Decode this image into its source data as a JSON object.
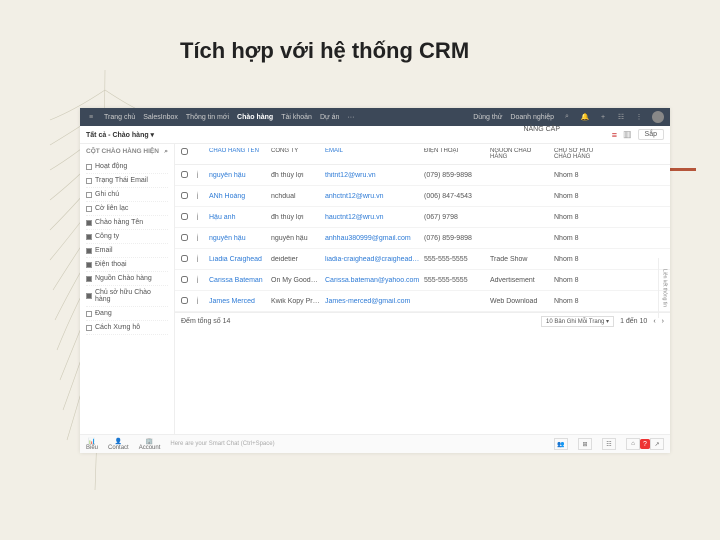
{
  "slide": {
    "title": "Tích hợp với hệ thống CRM"
  },
  "topnav": {
    "items": [
      "Trang chủ",
      "SalesInbox",
      "Thông tin mới",
      "Chào hàng",
      "Tài khoản",
      "Dự án",
      "···"
    ],
    "active_index": 3,
    "right": {
      "trial": "Dùng thử",
      "org": "Doanh nghiệp",
      "upgrade": "NÂNG CẤP"
    }
  },
  "subbar": {
    "view_label": "Tất cả - Chào hàng ▾",
    "sort_btn": "Sắp"
  },
  "sidebar": {
    "header": "CỘT CHÀO HÀNG HIỆN",
    "items": [
      {
        "label": "Hoạt động",
        "checked": false
      },
      {
        "label": "Trạng Thái Email",
        "checked": false
      },
      {
        "label": "Ghi chú",
        "checked": false
      },
      {
        "label": "Cờ liên lạc",
        "checked": false
      },
      {
        "label": "Chào hàng Tên",
        "checked": true
      },
      {
        "label": "Công ty",
        "checked": true
      },
      {
        "label": "Email",
        "checked": true
      },
      {
        "label": "Điện thoại",
        "checked": true
      },
      {
        "label": "Nguồn Chào hàng",
        "checked": true
      },
      {
        "label": "Chủ sở hữu Chào hàng",
        "checked": true
      },
      {
        "label": "Đang",
        "checked": false
      },
      {
        "label": "Cách Xưng hô",
        "checked": false
      }
    ]
  },
  "table": {
    "columns": [
      "",
      "CHÀO HÀNG TÊN",
      "CÔNG TY",
      "EMAIL",
      "ĐIỆN THOẠI",
      "NGUỒN CHÀO HÀNG",
      "CHỦ SỞ HỮU CHÀO HÀNG"
    ],
    "rows": [
      {
        "name": "nguyễn hậu",
        "company": "đh thủy lợi",
        "email": "thitnt12@wru.vn",
        "phone": "(079) 859-9898",
        "source": "",
        "owner": "Nhom 8"
      },
      {
        "name": "ANh Hoàng",
        "company": "nchdual",
        "email": "anhctnt12@wru.vn",
        "phone": "(006) 847-4543",
        "source": "",
        "owner": "Nhom 8"
      },
      {
        "name": "Hậu anh",
        "company": "đh thủy lợi",
        "email": "hauctnt12@wru.vn",
        "phone": "(067) 9798",
        "source": "",
        "owner": "Nhom 8"
      },
      {
        "name": "nguyễn hậu",
        "company": "nguyễn hậu",
        "email": "anhhau380999@gmail.com",
        "phone": "(076) 859-9898",
        "source": "",
        "owner": "Nhom 8"
      },
      {
        "name": "Liadia Craighead",
        "company": "deidetier",
        "email": "liadia-craighead@craighead.org",
        "phone": "555-555-5555",
        "source": "Trade Show",
        "owner": "Nhom 8"
      },
      {
        "name": "Carissa Bateman",
        "company": "On My Goodknits Inc",
        "email": "Carissa.bateman@yahoo.com",
        "phone": "555-555-5555",
        "source": "Advertisement",
        "owner": "Nhom 8"
      },
      {
        "name": "James Merced",
        "company": "Kwik Kopy Printing",
        "email": "James-merced@gmail.com",
        "phone": "",
        "source": "Web Download",
        "owner": "Nhom 8"
      }
    ],
    "footer": {
      "total": "Đếm tổng số 14",
      "per_page_label": "10 Bản Ghi Mỗi Trang ▾",
      "page_info": "1 đến 10"
    }
  },
  "bottombar": {
    "items": [
      "Biểu",
      "Contact",
      "Account"
    ],
    "hint": "Here are your Smart Chat (Ctrl+Space)"
  },
  "side_panel": {
    "label": "Liên kết thông tin"
  },
  "help_badge": "?"
}
